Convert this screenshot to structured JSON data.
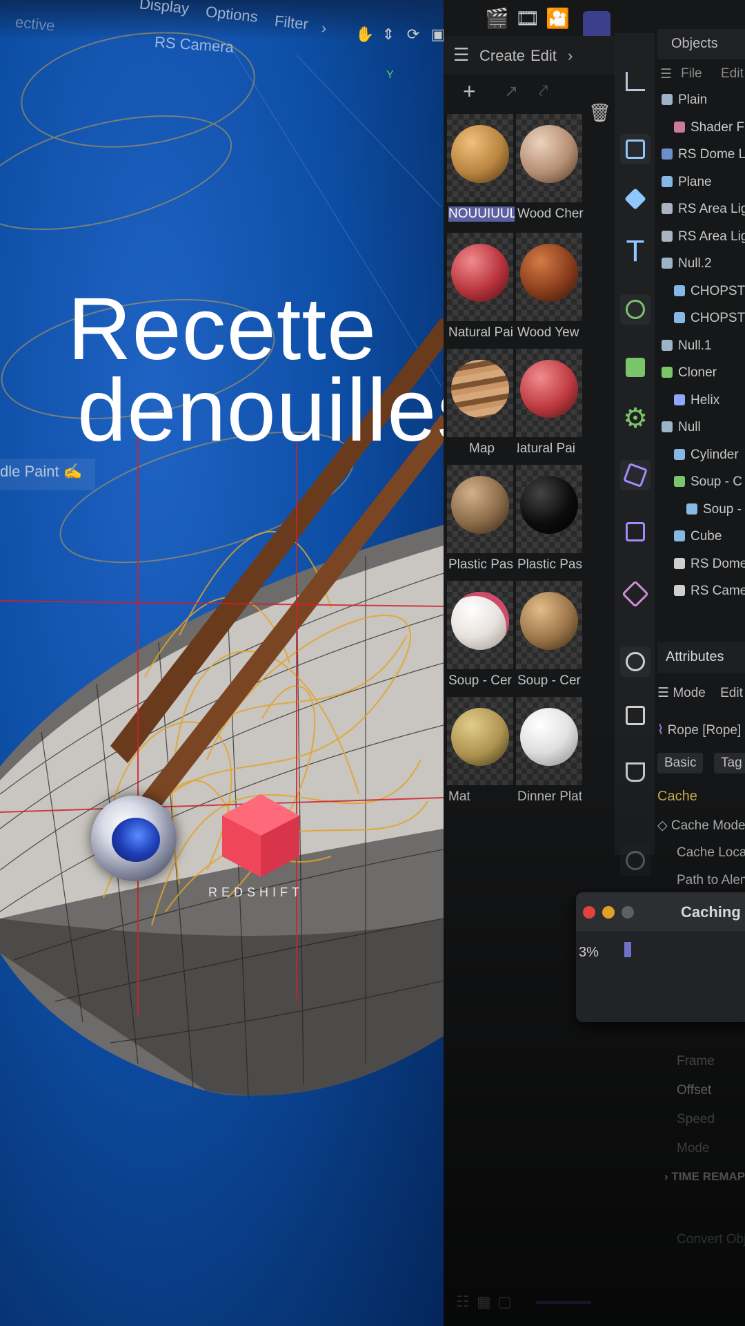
{
  "viewport": {
    "menu": [
      "Display",
      "Options",
      "Filter"
    ],
    "menu_partial": "ective",
    "camera_label": "RS Camera",
    "paint_label": "dle Paint",
    "axis_y": "Y",
    "title_line1": "Recette",
    "title_line2": "denouilles",
    "redshift_text": "REDSHIFT"
  },
  "materials": {
    "header": [
      "Create",
      "Edit"
    ],
    "items": [
      {
        "name": "NOUUIUUL",
        "color": "#b8843f",
        "selected": true
      },
      {
        "name": "Wood Cher",
        "color": "#b58f72"
      },
      {
        "name": "Natural Pai",
        "color": "#b8333c"
      },
      {
        "name": "Wood Yew",
        "color": "#8a3d1d"
      },
      {
        "name": "Map",
        "color": "#a7764b"
      },
      {
        "name": "Natural Pai",
        "color": "#bf3b40"
      },
      {
        "name": "Plastic Pas",
        "color": "#8a6a48"
      },
      {
        "name": "Plastic Pas",
        "color": "#0c0c0c"
      },
      {
        "name": "Soup - Cer",
        "color": "#e7e2dd"
      },
      {
        "name": "Soup - Cer",
        "color": "#9a7448"
      },
      {
        "name": "Mat",
        "color": "#b19651"
      },
      {
        "name": "Dinner Plat",
        "color": "#e4e4e4"
      }
    ]
  },
  "objects": {
    "tab": "Objects",
    "menu": [
      "File",
      "Edit"
    ],
    "rows": [
      {
        "label": "Plain",
        "indent": 0,
        "color": "#9fb3c8"
      },
      {
        "label": "Shader F",
        "indent": 1,
        "color": "#c97b9b"
      },
      {
        "label": "RS Dome L",
        "indent": 0,
        "color": "#6d8fc9"
      },
      {
        "label": "Plane",
        "indent": 0,
        "color": "#86b8e6"
      },
      {
        "label": "RS Area Lig",
        "indent": 0,
        "color": "#aab4c0"
      },
      {
        "label": "RS Area Lig",
        "indent": 0,
        "color": "#aab4c0"
      },
      {
        "label": "Null.2",
        "indent": 0,
        "color": "#9fb3c8"
      },
      {
        "label": "CHOPST",
        "indent": 1,
        "color": "#86b8e6"
      },
      {
        "label": "CHOPST",
        "indent": 1,
        "color": "#86b8e6"
      },
      {
        "label": "Null.1",
        "indent": 0,
        "color": "#9fb3c8"
      },
      {
        "label": "Cloner",
        "indent": 0,
        "color": "#7ac46b"
      },
      {
        "label": "Helix",
        "indent": 1,
        "color": "#8fa8ff"
      },
      {
        "label": "Null",
        "indent": 0,
        "color": "#9fb3c8"
      },
      {
        "label": "Cylinder",
        "indent": 1,
        "color": "#86b8e6"
      },
      {
        "label": "Soup - C",
        "indent": 1,
        "color": "#7ac46b"
      },
      {
        "label": "Soup -",
        "indent": 2,
        "color": "#86b8e6"
      },
      {
        "label": "Cube",
        "indent": 1,
        "color": "#86b8e6"
      },
      {
        "label": "RS Dome",
        "indent": 1,
        "color": "#cfcfcf"
      },
      {
        "label": "RS Came",
        "indent": 1,
        "color": "#cfcfcf"
      }
    ]
  },
  "attributes": {
    "tab": "Attributes",
    "menu": [
      "Mode",
      "Edit"
    ],
    "object": "Rope [Rope]",
    "tabs": [
      "Basic",
      "Tag"
    ],
    "section": "Cache",
    "rows": [
      "Cache Mode",
      "Cache Locat",
      "Path to Alem"
    ],
    "faded_rows": [
      "Frame",
      "Offset",
      "Speed",
      "Mode"
    ],
    "time_remap": "TIME REMAP",
    "convert": "Convert Obj"
  },
  "caching": {
    "title": "Caching Si",
    "percent": "3%",
    "progress": 0.03
  }
}
